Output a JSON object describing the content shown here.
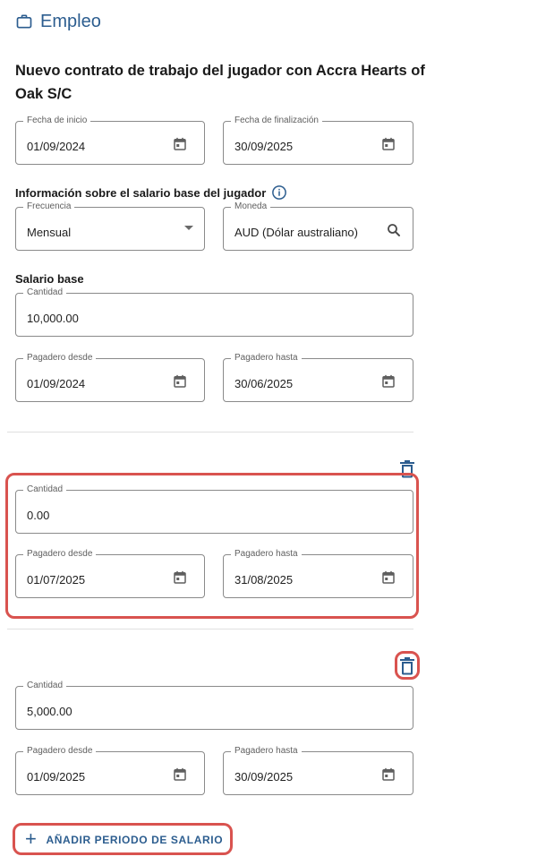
{
  "header": {
    "title": "Empleo",
    "icon": "briefcase-icon"
  },
  "contract": {
    "title": "Nuevo contrato de trabajo del jugador con Accra Hearts of Oak S/C",
    "start_date": {
      "label": "Fecha de inicio",
      "value": "01/09/2024"
    },
    "end_date": {
      "label": "Fecha de finalización",
      "value": "30/09/2025"
    }
  },
  "salary_info": {
    "heading": "Información sobre el salario base del jugador",
    "frequency": {
      "label": "Frecuencia",
      "value": "Mensual"
    },
    "currency": {
      "label": "Moneda",
      "value": "AUD (Dólar australiano)"
    }
  },
  "base_salary": {
    "heading": "Salario base",
    "periods": [
      {
        "amount_label": "Cantidad",
        "amount": "10,000.00",
        "from_label": "Pagadero desde",
        "from": "01/09/2024",
        "to_label": "Pagadero hasta",
        "to": "30/06/2025"
      },
      {
        "amount_label": "Cantidad",
        "amount": "0.00",
        "from_label": "Pagadero desde",
        "from": "01/07/2025",
        "to_label": "Pagadero hasta",
        "to": "31/08/2025"
      },
      {
        "amount_label": "Cantidad",
        "amount": "5,000.00",
        "from_label": "Pagadero desde",
        "from": "01/09/2025",
        "to_label": "Pagadero hasta",
        "to": "30/09/2025"
      }
    ]
  },
  "add_button": {
    "label": "AÑADIR PERIODO DE SALARIO"
  },
  "colors": {
    "accent": "#2c5d8f",
    "highlight": "#d9534f",
    "border": "#8a8a8a"
  }
}
